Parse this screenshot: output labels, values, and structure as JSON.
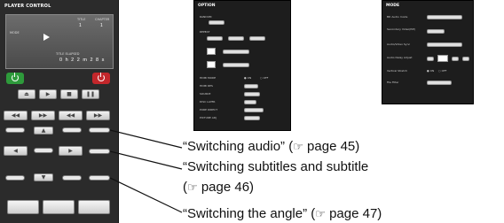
{
  "player": {
    "title": "PLAYER CONTROL",
    "screen": {
      "mode_label": "MODE",
      "title_label": "TITLE",
      "title_value": "1",
      "chapter_label": "CHAPTER",
      "chapter_value": "1",
      "elapsed_label": "TITLE ELAPSED",
      "elapsed_value": "0 h 2 2 m 2 8 s"
    }
  },
  "option_panel": {
    "title": "OPTION",
    "rows": [
      "RANDOM",
      "REPEAT",
      "HDMI MODE",
      "HDMI RES",
      "SOURCE",
      "DISC LAYER",
      "PURE DIRECT",
      "PICTURE ADJ"
    ],
    "hdmi_on": "ON",
    "hdmi_off": "OFF"
  },
  "mode_panel": {
    "title": "MODE",
    "rows": [
      "BD Audio mode",
      "Secondary Video(PiP)",
      "Audio/Video Sync",
      "Audio Delay Adjust",
      "Vertical Stretch",
      "File Filter"
    ],
    "stretch_on": "ON",
    "stretch_off": "OFF"
  },
  "callouts": [
    {
      "text_before": "“Switching audio” (",
      "icon": "☞",
      "text_after": " page 45)"
    },
    {
      "text_before": "“Switching   subtitles   and   subtitle",
      "icon": "",
      "text_after": ""
    },
    {
      "text_before": "(",
      "icon": "☞",
      "text_after": " page 46)"
    },
    {
      "text_before": "“Switching the angle” (",
      "icon": "☞",
      "text_after": " page 47)"
    }
  ]
}
